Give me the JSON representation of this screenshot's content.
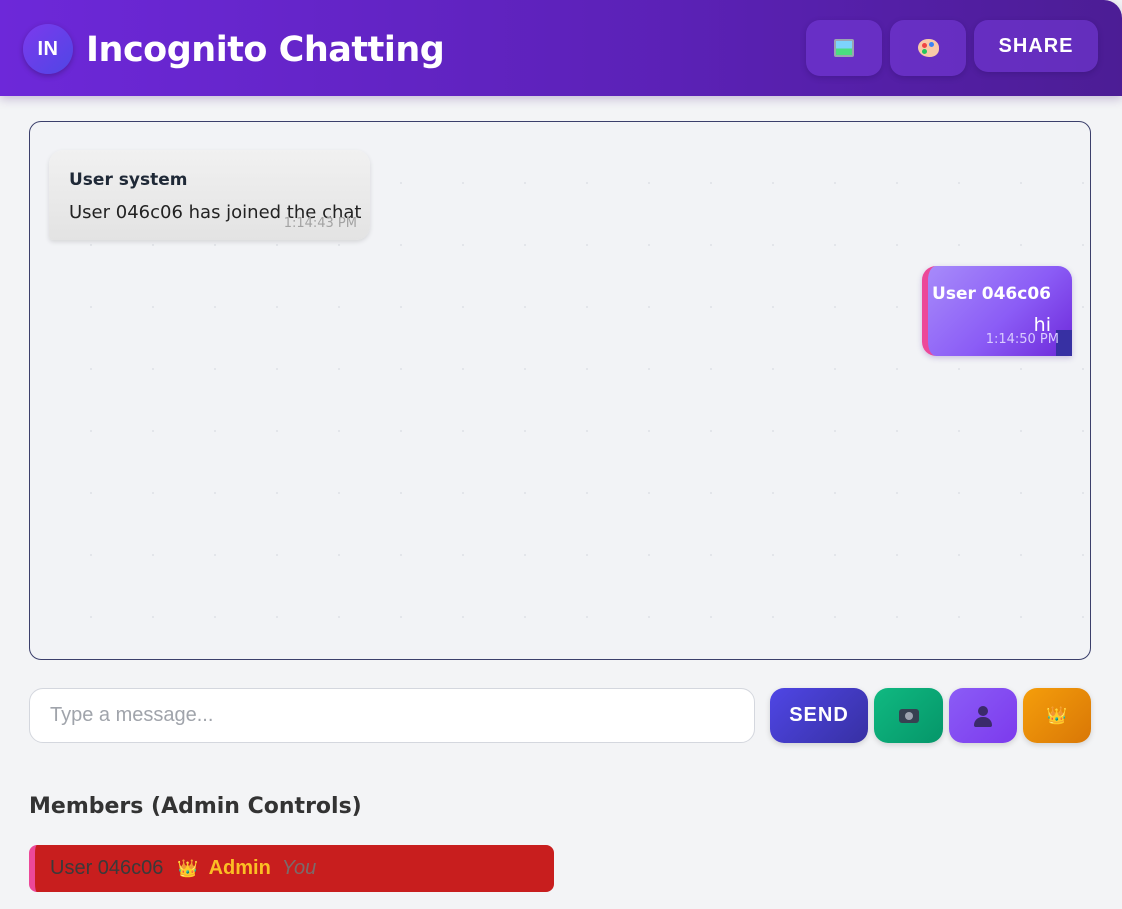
{
  "header": {
    "logo_initials": "IN",
    "title": "Incognito Chatting",
    "buttons": {
      "image_icon": "framed-picture-icon",
      "theme_icon": "palette-icon",
      "share_label": "SHARE"
    }
  },
  "messages": [
    {
      "sender": "User system",
      "text": "User 046c06 has joined the chat",
      "time": "1:14:43 PM",
      "side": "left"
    },
    {
      "sender": "User 046c06",
      "text": "hi",
      "time": "1:14:50 PM",
      "side": "right"
    }
  ],
  "composer": {
    "placeholder": "Type a message...",
    "value": "",
    "send_label": "SEND",
    "camera_icon": "camera-icon",
    "user_icon": "bust-in-silhouette-icon",
    "crown_icon": "crown-icon"
  },
  "members": {
    "title": "Members (Admin Controls)",
    "items": [
      {
        "name": "User 046c06",
        "crown": "👑",
        "role": "Admin",
        "tag": "You"
      }
    ]
  },
  "colors": {
    "header_gradient_start": "#6d28d9",
    "header_gradient_end": "#4c1d95",
    "own_message_accent": "#ec4899",
    "send_button": "#4338ca",
    "camera_button": "#10b981",
    "user_button": "#8b5cf6",
    "crown_button": "#f59e0b",
    "member_row_bg": "#c81e1e",
    "admin_label": "#fbbf24"
  }
}
